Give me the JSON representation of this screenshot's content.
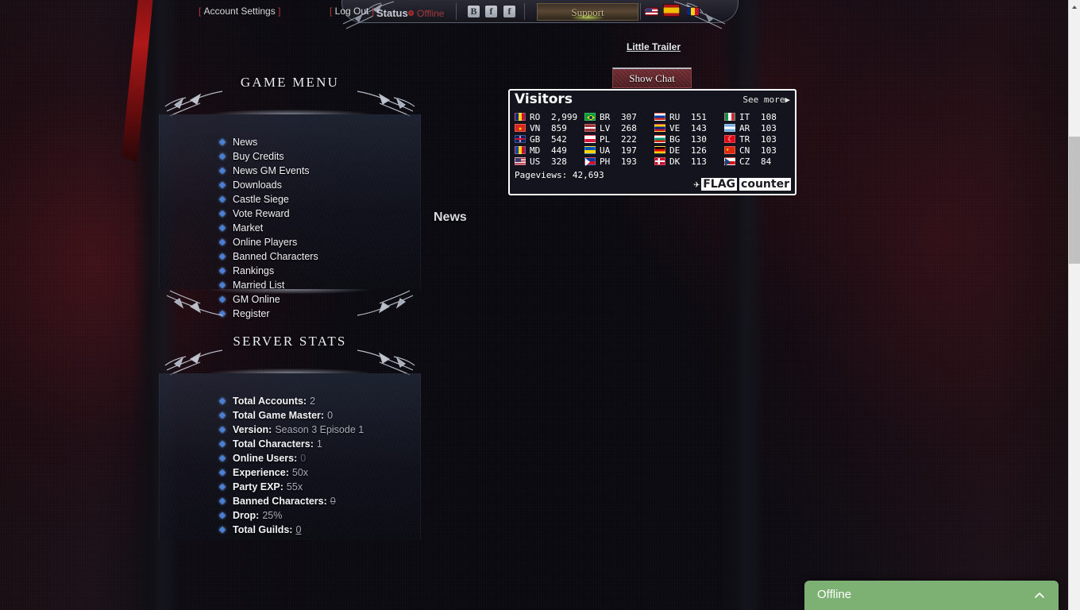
{
  "header": {
    "account_settings": "Account Settings",
    "logout": "Log Out",
    "status_label": "Status",
    "status_value": "Offline",
    "social": [
      {
        "name": "blogger-icon",
        "glyph": "B"
      },
      {
        "name": "facebook-icon",
        "glyph": "f"
      },
      {
        "name": "facebook-alt-icon",
        "glyph": "f"
      }
    ],
    "support_label": "Support",
    "language_flags": [
      "us-flag-icon",
      "es-flag-icon",
      "ro-flag-icon"
    ]
  },
  "game_menu": {
    "title": "GAME MENU",
    "items": [
      "News",
      "Buy Credits",
      "News GM Events",
      "Downloads",
      "Castle Siege",
      "Vote Reward",
      "Market",
      "Online Players",
      "Banned Characters",
      "Rankings",
      "Married List",
      "GM Online",
      "Register"
    ]
  },
  "server_stats": {
    "title": "SERVER STATS",
    "items": [
      {
        "label": "Total Accounts:",
        "value": "2",
        "style": "normal"
      },
      {
        "label": "Total Game Master:",
        "value": "0",
        "style": "normal"
      },
      {
        "label": "Version:",
        "value": "Season 3 Episode 1",
        "style": "normal"
      },
      {
        "label": "Total Characters:",
        "value": "1",
        "style": "normal"
      },
      {
        "label": "Online Users:",
        "value": "0",
        "style": "dim"
      },
      {
        "label": "Experience:",
        "value": "50x",
        "style": "normal"
      },
      {
        "label": "Party EXP:",
        "value": "55x",
        "style": "normal"
      },
      {
        "label": "Banned Characters:",
        "value": "0",
        "style": "strike"
      },
      {
        "label": "Drop:",
        "value": "25%",
        "style": "normal"
      },
      {
        "label": "Total Guilds:",
        "value": "0",
        "style": "link"
      }
    ]
  },
  "main": {
    "trailer_link": "Little Trailer",
    "show_chat_button": "Show Chat",
    "news_heading": "News"
  },
  "flag_counter": {
    "title": "Visitors",
    "see_more": "See more",
    "see_more_arrow": "▶",
    "pageviews_label": "Pageviews:",
    "pageviews_value": "42,693",
    "logo_mark": "✈",
    "logo_flag": "FLAG",
    "logo_counter": "counter",
    "columns": [
      [
        {
          "code": "RO",
          "count": "2,999",
          "flag": "f-ro"
        },
        {
          "code": "VN",
          "count": "859",
          "flag": "f-vn"
        },
        {
          "code": "GB",
          "count": "542",
          "flag": "f-gb"
        },
        {
          "code": "MD",
          "count": "449",
          "flag": "f-md"
        },
        {
          "code": "US",
          "count": "328",
          "flag": "f-us"
        }
      ],
      [
        {
          "code": "BR",
          "count": "307",
          "flag": "f-br"
        },
        {
          "code": "LV",
          "count": "268",
          "flag": "f-lv"
        },
        {
          "code": "PL",
          "count": "222",
          "flag": "f-pl"
        },
        {
          "code": "UA",
          "count": "197",
          "flag": "f-ua"
        },
        {
          "code": "PH",
          "count": "193",
          "flag": "f-ph"
        }
      ],
      [
        {
          "code": "RU",
          "count": "151",
          "flag": "f-ru"
        },
        {
          "code": "VE",
          "count": "143",
          "flag": "f-ve"
        },
        {
          "code": "BG",
          "count": "130",
          "flag": "f-bg"
        },
        {
          "code": "DE",
          "count": "126",
          "flag": "f-de"
        },
        {
          "code": "DK",
          "count": "113",
          "flag": "f-dk"
        }
      ],
      [
        {
          "code": "IT",
          "count": "108",
          "flag": "f-it"
        },
        {
          "code": "AR",
          "count": "103",
          "flag": "f-ar"
        },
        {
          "code": "TR",
          "count": "103",
          "flag": "f-tr"
        },
        {
          "code": "CN",
          "count": "103",
          "flag": "f-cn"
        },
        {
          "code": "CZ",
          "count": "84",
          "flag": "f-cz"
        }
      ]
    ]
  },
  "chat_widget": {
    "label": "Offline"
  },
  "colors": {
    "accent_red": "#b03a3a",
    "bullet_blue": "#4a7fd4",
    "chat_green": "#7db173",
    "panel_text": "#f0f1f4"
  }
}
